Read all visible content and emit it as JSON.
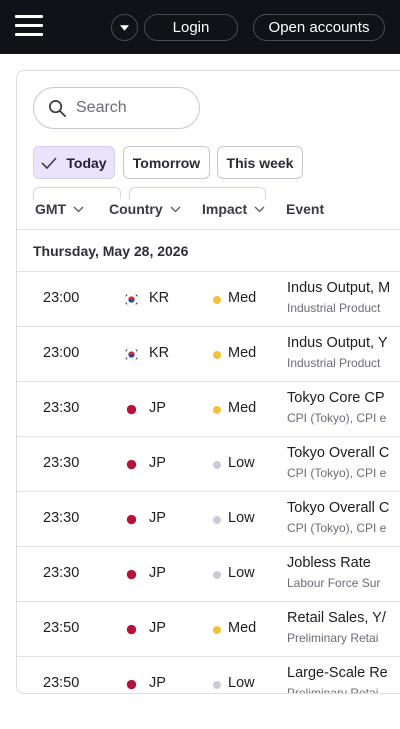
{
  "header": {
    "menu_icon": "hamburger-icon",
    "language_icon": "caret-down-icon",
    "login_label": "Login",
    "open_accounts_label": "Open accounts"
  },
  "search": {
    "placeholder": "Search",
    "icon": "search-icon"
  },
  "filters": {
    "today": "Today",
    "tomorrow": "Tomorrow",
    "this_week": "This week",
    "active": "Today"
  },
  "columns": {
    "gmt": "GMT",
    "country": "Country",
    "impact": "Impact",
    "event": "Event"
  },
  "date_header": "Thursday, May 28, 2026",
  "colors": {
    "medium": "#f5c13b",
    "low": "#c9ccd8",
    "accent": "#e9e4fb",
    "topbar": "#111218"
  },
  "rows": [
    {
      "time": "23:00",
      "country": "KR",
      "flag": "south-korea-flag-icon",
      "impact": "Med",
      "event": "Indus Output, M",
      "detail": "Industrial Product"
    },
    {
      "time": "23:00",
      "country": "KR",
      "flag": "south-korea-flag-icon",
      "impact": "Med",
      "event": "Indus Output, Y",
      "detail": "Industrial Product"
    },
    {
      "time": "23:30",
      "country": "JP",
      "flag": "japan-flag-icon",
      "impact": "Med",
      "event": "Tokyo Core CP",
      "detail": "CPI (Tokyo), CPI e"
    },
    {
      "time": "23:30",
      "country": "JP",
      "flag": "japan-flag-icon",
      "impact": "Low",
      "event": "Tokyo Overall C",
      "detail": "CPI (Tokyo), CPI e"
    },
    {
      "time": "23:30",
      "country": "JP",
      "flag": "japan-flag-icon",
      "impact": "Low",
      "event": "Tokyo Overall C",
      "detail": "CPI (Tokyo), CPI e"
    },
    {
      "time": "23:30",
      "country": "JP",
      "flag": "japan-flag-icon",
      "impact": "Low",
      "event": "Jobless Rate",
      "detail": "Labour Force Sur"
    },
    {
      "time": "23:50",
      "country": "JP",
      "flag": "japan-flag-icon",
      "impact": "Med",
      "event": "Retail Sales, Y/",
      "detail": "Preliminary Retai"
    },
    {
      "time": "23:50",
      "country": "JP",
      "flag": "japan-flag-icon",
      "impact": "Low",
      "event": "Large-Scale Re",
      "detail": "Preliminary Retai"
    }
  ]
}
